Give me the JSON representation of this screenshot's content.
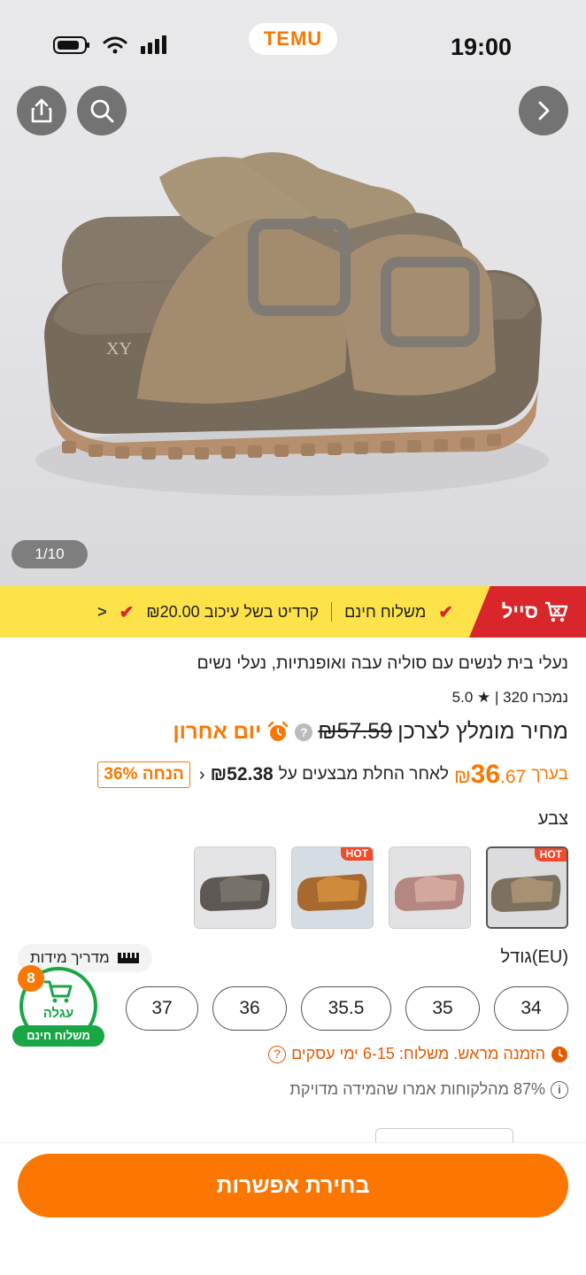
{
  "status_bar": {
    "time": "19:00",
    "brand": "TEMU"
  },
  "gallery": {
    "counter": "1/10"
  },
  "promo": {
    "sale": "סייל",
    "free_shipping": "משלוח חינם",
    "credit": "קרדיט בשל עיכוב ₪20.00",
    "chevron": "<"
  },
  "product": {
    "title": "נעלי בית לנשים עם סוליה עבה ואופנתיות, נעלי נשים",
    "rating": "5.0",
    "sold": "נמכרו 320",
    "price_label": "מחיר מומלץ לצרכן",
    "old_price": "₪57.59",
    "last_day": "יום אחרון",
    "est_prefix": "בערך",
    "est_price_main": "36",
    "est_price_cents": ".67",
    "est_currency": "₪",
    "est_text": "לאחר החלת מבצעים על",
    "est_base": "₪52.38",
    "discount": "הנחה 36%"
  },
  "color": {
    "label": "צבע",
    "hot_label": "HOT"
  },
  "size": {
    "label": "גודל(EU)",
    "guide": "מדריך מידות",
    "options": [
      "34",
      "35",
      "35.5",
      "36",
      "37"
    ]
  },
  "shipping": {
    "text": "הזמנה מראש. משלוח: 6-15 ימי עסקים"
  },
  "fit": {
    "text": "87% מהלקוחות אמרו שהמידה מדויקת"
  },
  "cart": {
    "count": "8",
    "label": "עגלה",
    "free": "משלוח חינם"
  },
  "cta": {
    "label": "בחירת אפשרות"
  },
  "colors": {
    "accent": "#fb7701",
    "promo_bg": "#fde24a",
    "sale_red": "#d8262a",
    "cart_green": "#19a645"
  }
}
